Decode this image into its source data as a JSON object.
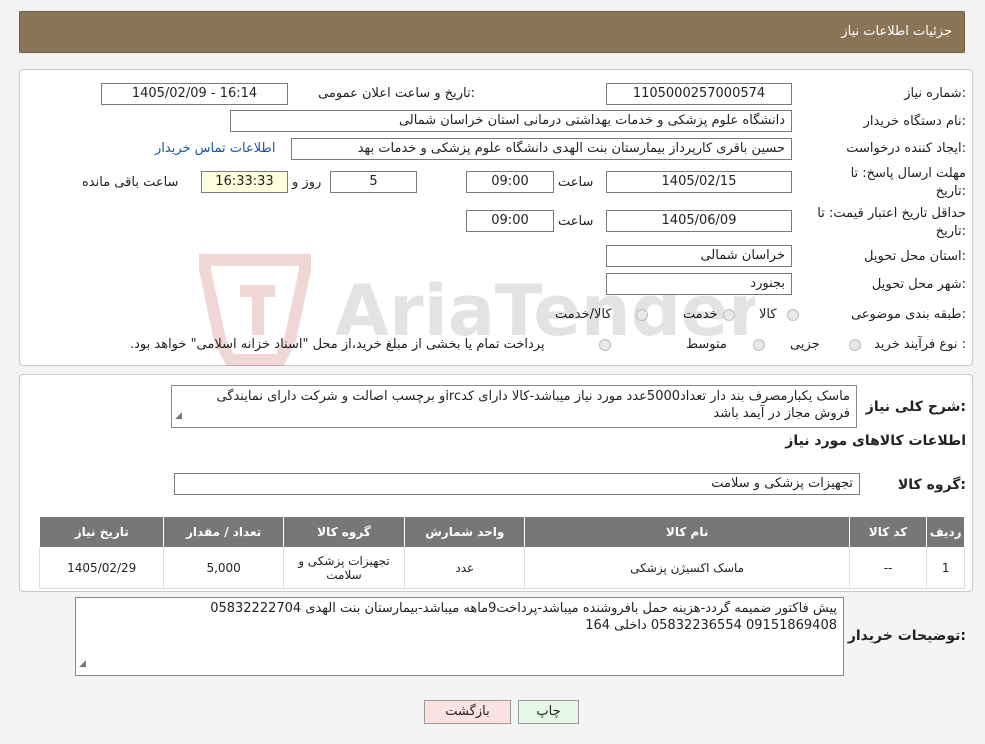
{
  "header": {
    "title": "جزئیات اطلاعات نیاز"
  },
  "form": {
    "need_number_label": "شماره نیاز:",
    "need_number": "1105000257000574",
    "announce_label": "تاریخ و ساعت اعلان عمومی:",
    "announce_value": "1405/02/09 - 16:14",
    "buyer_org_label": "نام دستگاه خریدار:",
    "buyer_org": "دانشگاه علوم پزشکی و خدمات بهداشتی درمانی استان خراسان شمالی",
    "creator_label": "ایجاد کننده درخواست:",
    "creator": "حسین باقری کارپرداز بیمارستان بنت الهدی دانشگاه علوم پزشکی و خدمات بهد",
    "contact_link": "اطلاعات تماس خریدار",
    "deadline_label_1": "مهلت ارسال پاسخ: تا",
    "deadline_label_2": "تاریخ:",
    "deadline_date": "1405/02/15",
    "time_label": "ساعت",
    "deadline_time": "09:00",
    "days_value": "5",
    "days_label": "روز و",
    "remaining_time": "16:33:33",
    "remaining_label": "ساعت باقی مانده",
    "validity_label_1": "حداقل تاریخ اعتبار قیمت: تا",
    "validity_label_2": "تاریخ:",
    "validity_date": "1405/06/09",
    "validity_time_label": "ساعت",
    "validity_time": "09:00",
    "province_label": "استان محل تحویل:",
    "province": "خراسان شمالی",
    "city_label": "شهر محل تحویل:",
    "city": "بجنورد",
    "category_label": "طبقه بندی موضوعی:",
    "category_options": [
      "کالا",
      "خدمت",
      "کالا/خدمت"
    ],
    "process_label": "نوع فرآیند خرید :",
    "process_options": [
      "جزیی",
      "متوسط"
    ],
    "process_note": "پرداخت تمام یا بخشی از مبلغ خرید،از محل \"اسناد خزانه اسلامی\" خواهد بود."
  },
  "description": {
    "label": "شرح کلی نیاز:",
    "text": "ماسک یکبارمصرف بند دار  تعداد5000عدد مورد نیاز میباشد-کالا دارای کدircو برچسب اصالت و شرکت دارای نمایندگی فروش مجاز در آیمد باشد"
  },
  "goods": {
    "section_title": "اطلاعات کالاهای مورد نیاز",
    "group_label": "گروه کالا:",
    "group_value": "تجهیزات پزشکی و سلامت",
    "columns": [
      "ردیف",
      "کد کالا",
      "نام کالا",
      "واحد شمارش",
      "گروه کالا",
      "تعداد / مقدار",
      "تاریخ نیاز"
    ],
    "rows": [
      [
        "1",
        "--",
        "ماسک اکسیژن پزشکی",
        "عدد",
        "تجهیزات پزشکی و سلامت",
        "5,000",
        "1405/02/29"
      ]
    ]
  },
  "buyer_notes": {
    "label": "توضیحات خریدار:",
    "line1": "پیش فاکتور ضمیمه گردد-هزینه حمل بافروشنده میباشد-پرداخت9ماهه میباشد-بیمارستان بنت الهدی 05832222704",
    "line2": "09151869408 05832236554  داخلی 164"
  },
  "buttons": {
    "print": "چاپ",
    "back": "بازگشت"
  },
  "watermark": "AriaTender.neT"
}
